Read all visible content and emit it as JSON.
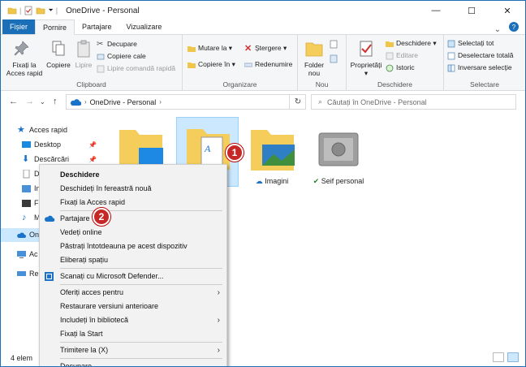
{
  "window": {
    "title": "OneDrive - Personal",
    "minimize": "—",
    "maximize": "☐",
    "close": "✕"
  },
  "tabs": [
    "Fișier",
    "Pornire",
    "Partajare",
    "Vizualizare"
  ],
  "ribbon": {
    "pin_label": "Fixați la\nAcces rapid",
    "copy_label": "Copiere",
    "paste_label": "Lipire",
    "cut_label": "Decupare",
    "copy_path_label": "Copiere cale",
    "paste_shortcut_label": "Lipire comandă rapidă",
    "clipboard_group": "Clipboard",
    "move_to_label": "Mutare la ▾",
    "copy_to_label": "Copiere în ▾",
    "delete_label": "Ștergere ▾",
    "rename_label": "Redenumire",
    "organize_group": "Organizare",
    "new_folder_label": "Folder\nnou",
    "new_group": "Nou",
    "properties_label": "Proprietăți\n▾",
    "open_label": "Deschidere ▾",
    "edit_label": "Editare",
    "history_label": "Istoric",
    "open_group": "Deschidere",
    "select_all_label": "Selectați tot",
    "select_none_label": "Deselectare totală",
    "invert_label": "Inversare selecție",
    "select_group": "Selectare"
  },
  "address": {
    "path": "OneDrive - Personal",
    "search_placeholder": "Căutați în OneDrive - Personal"
  },
  "sidebar": {
    "items": [
      "Acces rapid",
      "Desktop",
      "Descărcări",
      "D",
      "In",
      "Fi",
      "M",
      "On",
      "Ac",
      "Re"
    ]
  },
  "files": [
    {
      "name": ""
    },
    {
      "name": ""
    },
    {
      "name": "Imagini"
    },
    {
      "name": "Seif personal"
    }
  ],
  "context_menu": {
    "items": [
      "Deschidere",
      "Deschideți în fereastră nouă",
      "Fixați la Acces rapid",
      "Partajare",
      "Vedeți online",
      "Păstrați întotdeauna pe acest dispozitiv",
      "Eliberați spațiu",
      "Scanați cu Microsoft Defender...",
      "Oferiți acces pentru",
      "Restaurare versiuni anterioare",
      "Includeți în bibliotecă",
      "Fixați la Start",
      "Trimitere la (X)",
      "Decupare"
    ]
  },
  "status": {
    "count": "4 elem"
  },
  "badges": [
    "1",
    "2"
  ]
}
